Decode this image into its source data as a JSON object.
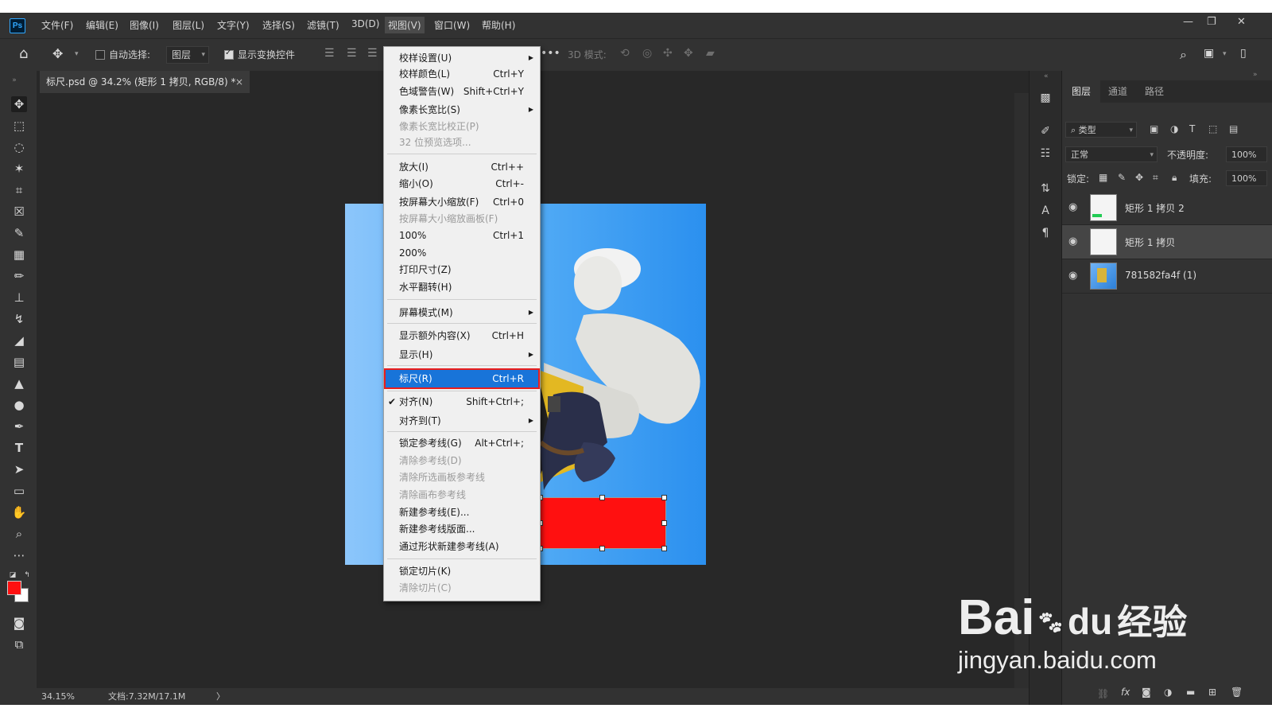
{
  "menubar": {
    "logo": "Ps",
    "items": [
      "文件(F)",
      "编辑(E)",
      "图像(I)",
      "图层(L)",
      "文字(Y)",
      "选择(S)",
      "滤镜(T)",
      "3D(D)",
      "视图(V)",
      "窗口(W)",
      "帮助(H)"
    ],
    "active": "视图(V)"
  },
  "options": {
    "auto_select_label": "自动选择:",
    "auto_select_value": "图层",
    "show_transform_label": "显示变换控件",
    "mode_3d_label": "3D 模式:"
  },
  "document": {
    "tab_title": "标尺.psd @ 34.2% (矩形 1 拷贝, RGB/8) *",
    "close_glyph": "×"
  },
  "status": {
    "zoom": "34.15%",
    "doc_size": "文档:7.32M/17.1M",
    "arrow": "〉"
  },
  "view_menu": {
    "items": [
      {
        "label": "校样设置(U)",
        "shortcut": "",
        "submenu": true,
        "disabled": false
      },
      {
        "label": "校样颜色(L)",
        "shortcut": "Ctrl+Y",
        "disabled": false
      },
      {
        "label": "色域警告(W)",
        "shortcut": "Shift+Ctrl+Y",
        "disabled": false
      },
      {
        "label": "像素长宽比(S)",
        "shortcut": "",
        "submenu": true,
        "disabled": false
      },
      {
        "label": "像素长宽比校正(P)",
        "shortcut": "",
        "disabled": true
      },
      {
        "label": "32 位预览选项...",
        "shortcut": "",
        "disabled": true
      },
      {
        "label": "放大(I)",
        "shortcut": "Ctrl++",
        "disabled": false
      },
      {
        "label": "缩小(O)",
        "shortcut": "Ctrl+-",
        "disabled": false
      },
      {
        "label": "按屏幕大小缩放(F)",
        "shortcut": "Ctrl+0",
        "disabled": false
      },
      {
        "label": "按屏幕大小缩放画板(F)",
        "shortcut": "",
        "disabled": true
      },
      {
        "label": "100%",
        "shortcut": "Ctrl+1",
        "disabled": false
      },
      {
        "label": "200%",
        "shortcut": "",
        "disabled": false
      },
      {
        "label": "打印尺寸(Z)",
        "shortcut": "",
        "disabled": false
      },
      {
        "label": "水平翻转(H)",
        "shortcut": "",
        "disabled": false
      },
      {
        "label": "屏幕模式(M)",
        "shortcut": "",
        "submenu": true,
        "disabled": false
      },
      {
        "label": "显示额外内容(X)",
        "shortcut": "Ctrl+H",
        "disabled": false
      },
      {
        "label": "显示(H)",
        "shortcut": "",
        "submenu": true,
        "disabled": false
      },
      {
        "label": "标尺(R)",
        "shortcut": "Ctrl+R",
        "disabled": false,
        "highlighted": true
      },
      {
        "label": "对齐(N)",
        "shortcut": "Shift+Ctrl+;",
        "disabled": false,
        "checked": true
      },
      {
        "label": "对齐到(T)",
        "shortcut": "",
        "submenu": true,
        "disabled": false
      },
      {
        "label": "锁定参考线(G)",
        "shortcut": "Alt+Ctrl+;",
        "disabled": false
      },
      {
        "label": "清除参考线(D)",
        "shortcut": "",
        "disabled": true
      },
      {
        "label": "清除所选画板参考线",
        "shortcut": "",
        "disabled": true
      },
      {
        "label": "清除画布参考线",
        "shortcut": "",
        "disabled": true
      },
      {
        "label": "新建参考线(E)...",
        "shortcut": "",
        "disabled": false
      },
      {
        "label": "新建参考线版面...",
        "shortcut": "",
        "disabled": false
      },
      {
        "label": "通过形状新建参考线(A)",
        "shortcut": "",
        "disabled": false
      },
      {
        "label": "锁定切片(K)",
        "shortcut": "",
        "disabled": false
      },
      {
        "label": "清除切片(C)",
        "shortcut": "",
        "disabled": true
      }
    ]
  },
  "layers_panel": {
    "tabs": [
      "图层",
      "通道",
      "路径"
    ],
    "filter_label": "类型",
    "blend_mode": "正常",
    "opacity_label": "不透明度:",
    "opacity_value": "100%",
    "lock_label": "锁定:",
    "fill_label": "填充:",
    "fill_value": "100%",
    "layers": [
      {
        "name": "矩形 1 拷贝 2",
        "selected": false
      },
      {
        "name": "矩形 1 拷贝",
        "selected": true
      },
      {
        "name": "781582fa4f (1)",
        "selected": false
      }
    ]
  },
  "watermark": {
    "logo_text": "Bai",
    "logo_du": "du",
    "logo_cn": "经验",
    "url": "jingyan.baidu.com"
  },
  "colors": {
    "foreground": "#ff1010",
    "background": "#ffffff",
    "highlight": "#1874d9",
    "highlight_outline": "#e81d1d"
  }
}
